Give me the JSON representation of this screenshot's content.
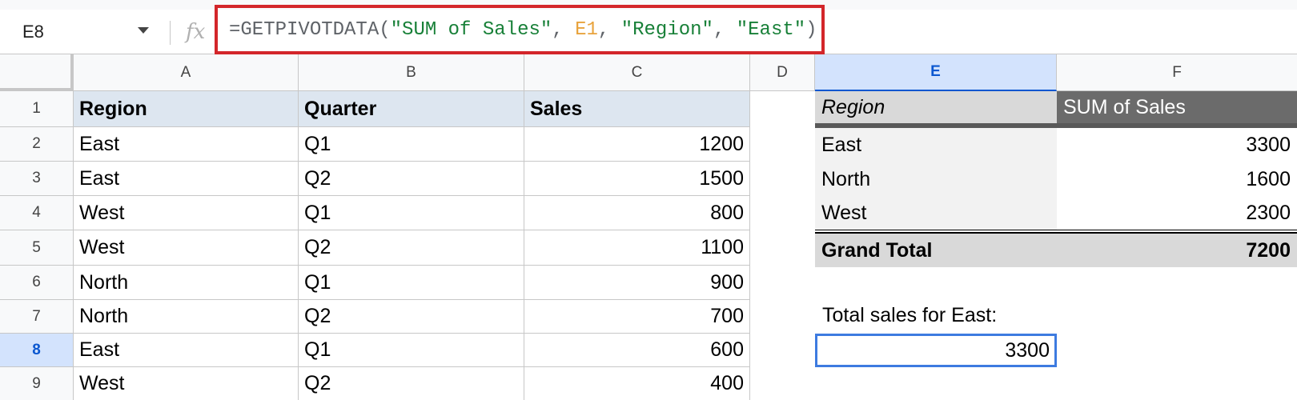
{
  "name_box": "E8",
  "formula_bar": {
    "fx": "fx",
    "tokens": {
      "t1": "=GETPIVOTDATA(",
      "t2": "\"SUM of Sales\"",
      "t3": ", ",
      "t4": "E1",
      "t5": ", ",
      "t6": "\"Region\"",
      "t7": ", ",
      "t8": "\"East\"",
      "t9": ")"
    }
  },
  "columns": [
    "A",
    "B",
    "C",
    "D",
    "E",
    "F"
  ],
  "rows": [
    "1",
    "2",
    "3",
    "4",
    "5",
    "6",
    "7",
    "8",
    "9"
  ],
  "table": {
    "headers": [
      "Region",
      "Quarter",
      "Sales"
    ],
    "data": [
      [
        "East",
        "Q1",
        "1200"
      ],
      [
        "East",
        "Q2",
        "1500"
      ],
      [
        "West",
        "Q1",
        "800"
      ],
      [
        "West",
        "Q2",
        "1100"
      ],
      [
        "North",
        "Q1",
        "900"
      ],
      [
        "North",
        "Q2",
        "700"
      ],
      [
        "East",
        "Q1",
        "600"
      ],
      [
        "West",
        "Q2",
        "400"
      ]
    ]
  },
  "pivot": {
    "row_header": "Region",
    "value_header": "SUM of Sales",
    "rows": [
      [
        "East",
        "3300"
      ],
      [
        "North",
        "1600"
      ],
      [
        "West",
        "2300"
      ]
    ],
    "grand_total_label": "Grand Total",
    "grand_total_value": "7200"
  },
  "note_label": "Total sales for East:",
  "result_value": "3300",
  "colors": {
    "selection": "#3d7be0",
    "formula_highlight": "#d3262a",
    "header_fill": "#dde6f0"
  }
}
